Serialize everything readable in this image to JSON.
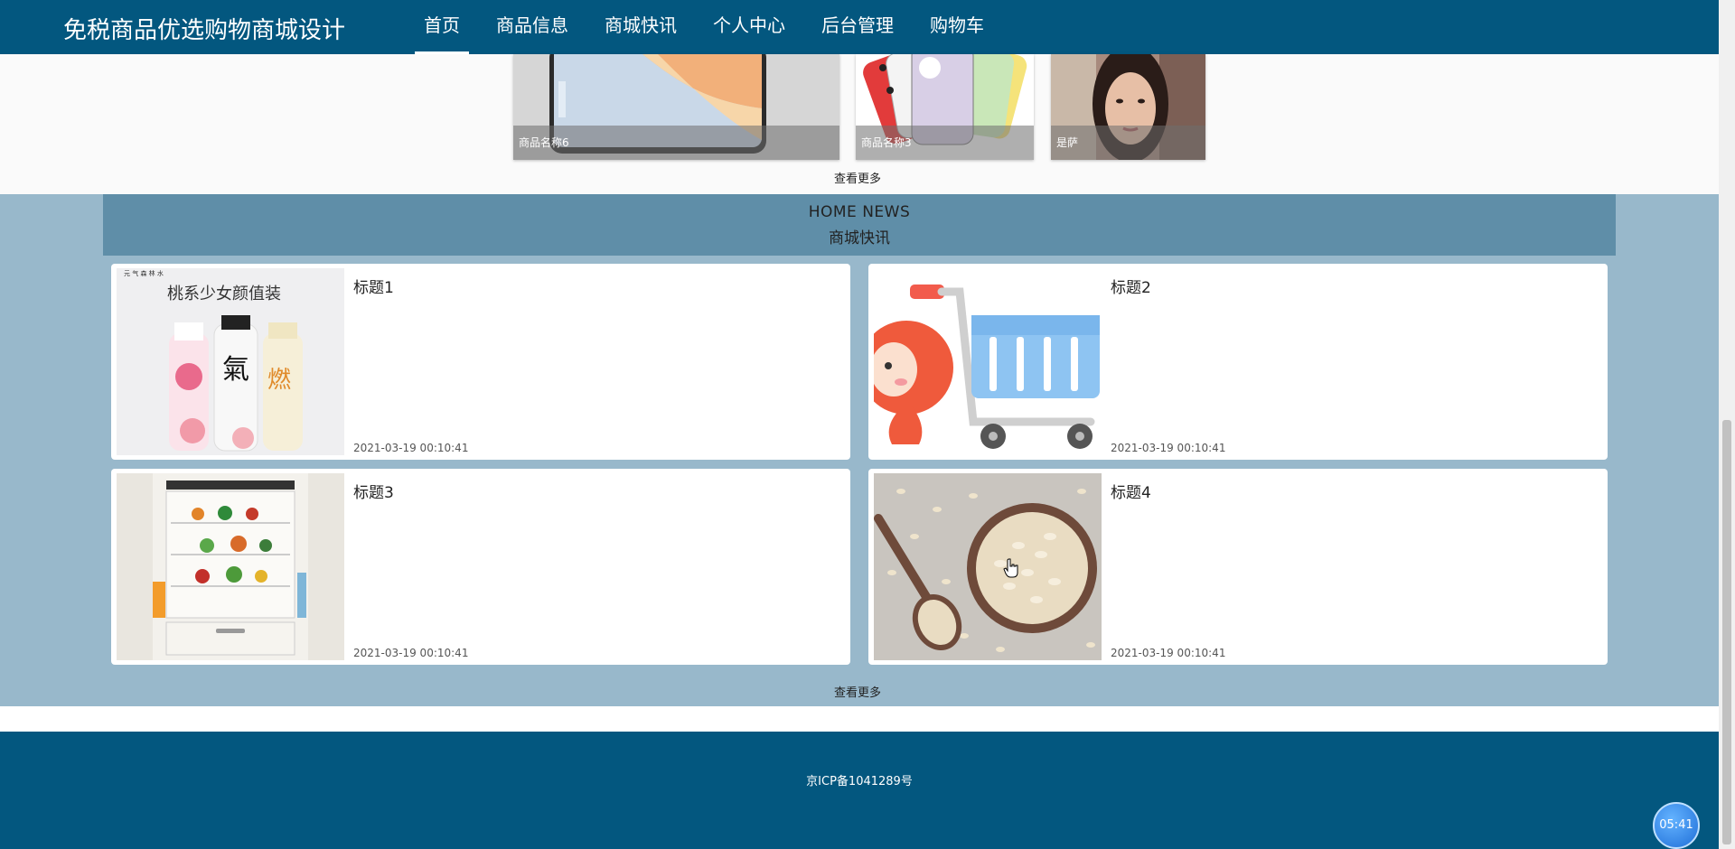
{
  "header": {
    "brand": "免税商品优选购物商城设计",
    "nav": [
      "首页",
      "商品信息",
      "商城快讯",
      "个人中心",
      "后台管理",
      "购物车"
    ],
    "active_index": 0
  },
  "products": {
    "items": [
      {
        "label": "商品名称6"
      },
      {
        "label": "商品名称3"
      },
      {
        "label": "是萨"
      }
    ],
    "more": "查看更多"
  },
  "news": {
    "title_en": "HOME NEWS",
    "title_cn": "商城快讯",
    "items": [
      {
        "title": "标题1",
        "date": "2021-03-19 00:10:41",
        "image": "drinks-image",
        "image_text": "桃系少女颜值装",
        "brand_text": "元 气 森 林 水",
        "bottle_text": "燃"
      },
      {
        "title": "标题2",
        "date": "2021-03-19 00:10:41",
        "image": "shopping-cart-image"
      },
      {
        "title": "标题3",
        "date": "2021-03-19 00:10:41",
        "image": "refrigerator-image"
      },
      {
        "title": "标题4",
        "date": "2021-03-19 00:10:41",
        "image": "oats-image"
      }
    ],
    "more": "查看更多"
  },
  "footer": {
    "icp": "京ICP备1041289号"
  },
  "clock": "05:41",
  "colors": {
    "header": "#03577f",
    "news_bg": "#98b8cb",
    "news_head": "#5f8ea8",
    "footer": "#03577f"
  }
}
